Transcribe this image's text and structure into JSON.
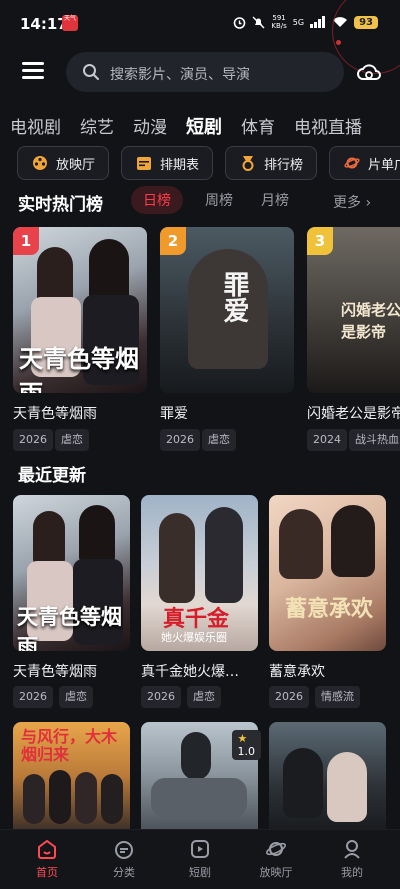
{
  "status": {
    "time": "14:17",
    "badge": "天气",
    "net_speed": "591",
    "net_unit": "KB/s",
    "signal": "5G",
    "battery": "93"
  },
  "search": {
    "placeholder": "搜索影片、演员、导演"
  },
  "categories": [
    "电视剧",
    "综艺",
    "动漫",
    "短剧",
    "体育",
    "电视直播"
  ],
  "active_category": "短剧",
  "quick_buttons": [
    "放映厅",
    "排期表",
    "排行榜",
    "片单广场"
  ],
  "hot": {
    "title": "实时热门榜",
    "tabs": [
      "日榜",
      "周榜",
      "月榜"
    ],
    "more": "更多",
    "items": [
      {
        "rank": "1",
        "title": "天青色等烟雨",
        "year": "2026",
        "genre": "虐恋",
        "poster_text": "天青色等烟雨",
        "rank_color": "#e8424a"
      },
      {
        "rank": "2",
        "title": "罪爱",
        "year": "2026",
        "genre": "虐恋",
        "poster_text": "罪爱",
        "rank_color": "#f09a2c"
      },
      {
        "rank": "3",
        "title": "闪婚老公是影帝",
        "year": "2024",
        "genre": "战斗热血",
        "poster_text": "闪婚老公是影帝",
        "rank_color": "#f0c23a"
      }
    ]
  },
  "recent": {
    "title": "最近更新",
    "items": [
      {
        "title": "天青色等烟雨",
        "year": "2026",
        "genre": "虐恋",
        "poster_text": "天青色等烟雨"
      },
      {
        "title": "真千金她火爆…",
        "year": "2026",
        "genre": "虐恋",
        "poster_text": "真千金",
        "poster_sub": "她火爆娱乐圈"
      },
      {
        "title": "蓄意承欢",
        "year": "2026",
        "genre": "情感流",
        "poster_text": "蓄意承欢"
      },
      {
        "poster_text": "与风行，大木烟归来"
      },
      {},
      {
        "score": "1.0"
      }
    ]
  },
  "nav": [
    {
      "label": "首页",
      "icon": "home-icon"
    },
    {
      "label": "分类",
      "icon": "category-icon"
    },
    {
      "label": "短剧",
      "icon": "short-drama-icon"
    },
    {
      "label": "放映厅",
      "icon": "planet-icon"
    },
    {
      "label": "我的",
      "icon": "profile-icon"
    }
  ],
  "colors": {
    "accent": "#ff3d4a",
    "background": "#121317"
  }
}
